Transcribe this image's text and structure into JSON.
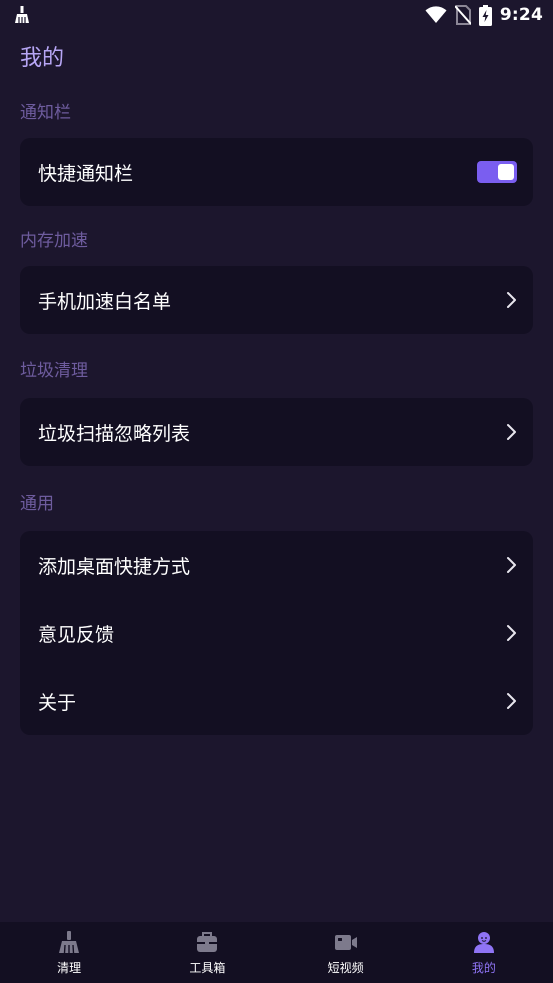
{
  "status_bar": {
    "time": "9:24",
    "icons": [
      "cleaner-notification-icon",
      "wifi-icon",
      "no-sim-icon",
      "battery-charging-icon"
    ]
  },
  "page": {
    "title": "我的"
  },
  "sections": [
    {
      "title": "通知栏",
      "items": [
        {
          "label": "快捷通知栏",
          "control": "toggle",
          "enabled": true
        }
      ]
    },
    {
      "title": "内存加速",
      "items": [
        {
          "label": "手机加速白名单",
          "control": "chevron-right-icon"
        }
      ]
    },
    {
      "title": "垃圾清理",
      "items": [
        {
          "label": "垃圾扫描忽略列表",
          "control": "chevron-right-icon"
        }
      ]
    },
    {
      "title": "通用",
      "items": [
        {
          "label": "添加桌面快捷方式",
          "control": "chevron-right-icon"
        },
        {
          "label": "意见反馈",
          "control": "chevron-right-icon"
        },
        {
          "label": "关于",
          "control": "chevron-right-icon"
        }
      ]
    }
  ],
  "bottom_nav": {
    "active_index": 3,
    "items": [
      {
        "label": "清理",
        "icon": "broom-icon"
      },
      {
        "label": "工具箱",
        "icon": "toolbox-icon"
      },
      {
        "label": "短视频",
        "icon": "video-camera-icon"
      },
      {
        "label": "我的",
        "icon": "user-profile-icon"
      }
    ]
  },
  "colors": {
    "background": "#1c162d",
    "card": "#130f22",
    "title": "#b7a6f5",
    "section_title": "#6e5c9e",
    "accent": "#7a5ef0",
    "nav_active": "#8f74f5"
  }
}
